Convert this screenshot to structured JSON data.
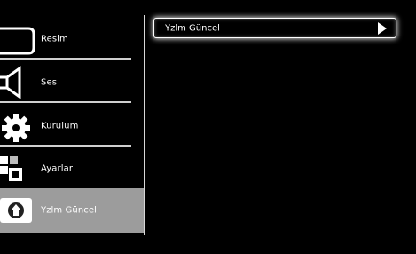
{
  "sidebar": {
    "items": [
      {
        "label": "Resim",
        "icon": "picture-icon"
      },
      {
        "label": "Ses",
        "icon": "speaker-icon"
      },
      {
        "label": "Kurulum",
        "icon": "gear-icon"
      },
      {
        "label": "Ayarlar",
        "icon": "preferences-icon"
      },
      {
        "label": "Yzlm Güncel",
        "icon": "software-update-icon",
        "active": true
      }
    ]
  },
  "panel": {
    "items": [
      {
        "label": "Yzlm Güncel"
      }
    ]
  },
  "colors": {
    "background": "#000000",
    "active_item": "#9c9c9c",
    "text": "#ffffff"
  }
}
